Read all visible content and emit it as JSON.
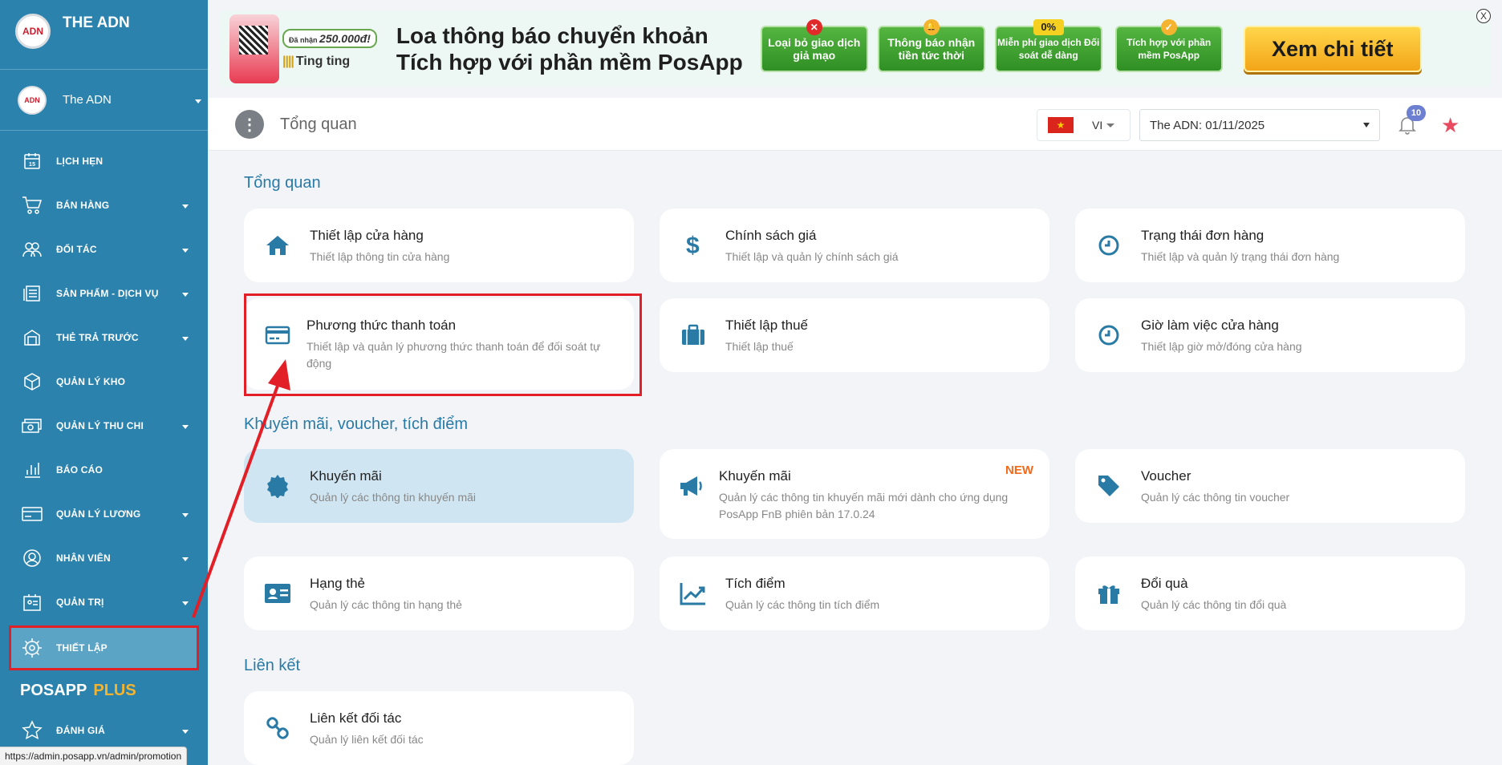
{
  "sidebar": {
    "brand": "THE ADN",
    "logo_text": "ADN",
    "account": "The ADN",
    "items": [
      {
        "label": "LỊCH HẸN",
        "icon": "calendar-icon",
        "has_caret": false
      },
      {
        "label": "BÁN HÀNG",
        "icon": "cart-icon",
        "has_caret": true
      },
      {
        "label": "ĐỐI TÁC",
        "icon": "partners-icon",
        "has_caret": true
      },
      {
        "label": "SẢN PHẨM - DỊCH VỤ",
        "icon": "products-icon",
        "has_caret": true
      },
      {
        "label": "THẺ TRẢ TRƯỚC",
        "icon": "prepaid-card-icon",
        "has_caret": true
      },
      {
        "label": "QUẢN LÝ KHO",
        "icon": "box-icon",
        "has_caret": false
      },
      {
        "label": "QUẢN LÝ THU CHI",
        "icon": "money-icon",
        "has_caret": true
      },
      {
        "label": "BÁO CÁO",
        "icon": "chart-icon",
        "has_caret": false
      },
      {
        "label": "QUẢN LÝ LƯƠNG",
        "icon": "payroll-icon",
        "has_caret": true
      },
      {
        "label": "NHÂN VIÊN",
        "icon": "user-icon",
        "has_caret": true
      },
      {
        "label": "QUẢN TRỊ",
        "icon": "admin-icon",
        "has_caret": true
      },
      {
        "label": "THIẾT LẬP",
        "icon": "gear-icon",
        "has_caret": false,
        "active": true
      }
    ],
    "plus_label_a": "POSAPP",
    "plus_label_b": "PLUS",
    "rating": "ĐÁNH GIÁ",
    "status_url": "https://admin.posapp.vn/admin/promotion"
  },
  "banner": {
    "reward_prefix": "Đã nhận",
    "reward_amount": "250.000đ!",
    "ting": "Ting ting",
    "line1": "Loa thông báo chuyển khoản",
    "line2": "Tích hợp với phần mềm PosApp",
    "pills": [
      {
        "text": "Loại bỏ giao dịch giả mạo",
        "badge": "✕",
        "badge_color": "#e02a2a"
      },
      {
        "text": "Thông báo nhận tiền tức thời",
        "badge": "🔔",
        "badge_color": "#f5b430"
      },
      {
        "text": "Miễn phí giao dịch Đối soát dễ dàng",
        "badge": "0%",
        "badge_color": "#f5d020"
      },
      {
        "text": "Tích hợp với phần mềm PosApp",
        "badge": "✓",
        "badge_color": "#f5b430"
      }
    ],
    "cta": "Xem chi tiết",
    "close": "X"
  },
  "header": {
    "title": "Tổng quan",
    "lang": "VI",
    "store": "The ADN: 01/11/2025",
    "notifications": "10"
  },
  "sections": [
    {
      "title": "Tổng quan",
      "cards": [
        {
          "title": "Thiết lập cửa hàng",
          "desc": "Thiết lập thông tin cửa hàng",
          "icon": "home-icon"
        },
        {
          "title": "Chính sách giá",
          "desc": "Thiết lập và quản lý chính sách giá",
          "icon": "dollar-icon"
        },
        {
          "title": "Trạng thái đơn hàng",
          "desc": "Thiết lập và quản lý trạng thái đơn hàng",
          "icon": "clock-icon"
        },
        {
          "title": "Phương thức thanh toán",
          "desc": "Thiết lập và quản lý phương thức thanh toán để đối soát tự động",
          "icon": "credit-card-icon"
        },
        {
          "title": "Thiết lập thuế",
          "desc": "Thiết lập thuế",
          "icon": "briefcase-icon"
        },
        {
          "title": "Giờ làm việc cửa hàng",
          "desc": "Thiết lập giờ mở/đóng cửa hàng",
          "icon": "clock-icon"
        }
      ]
    },
    {
      "title": "Khuyến mãi, voucher, tích điểm",
      "cards": [
        {
          "title": "Khuyến mãi",
          "desc": "Quản lý các thông tin khuyến mãi",
          "icon": "badge-icon"
        },
        {
          "title": "Khuyến mãi",
          "desc": "Quản lý các thông tin khuyến mãi mới dành cho ứng dụng PosApp FnB phiên bản 17.0.24",
          "icon": "megaphone-icon",
          "tag": "NEW"
        },
        {
          "title": "Voucher",
          "desc": "Quản lý các thông tin voucher",
          "icon": "tag-icon"
        },
        {
          "title": "Hạng thẻ",
          "desc": "Quản lý các thông tin hạng thẻ",
          "icon": "id-card-icon"
        },
        {
          "title": "Tích điểm",
          "desc": "Quản lý các thông tin tích điểm",
          "icon": "trend-icon"
        },
        {
          "title": "Đổi quà",
          "desc": "Quản lý các thông tin đổi quà",
          "icon": "gift-icon"
        }
      ]
    },
    {
      "title": "Liên kết",
      "cards": [
        {
          "title": "Liên kết đối tác",
          "desc": "Quản lý liên kết đối tác",
          "icon": "link-icon"
        }
      ]
    }
  ]
}
